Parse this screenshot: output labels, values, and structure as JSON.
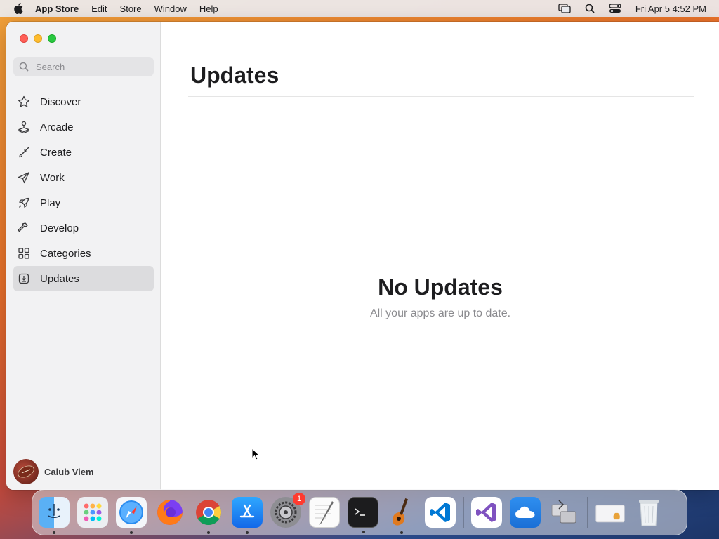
{
  "menubar": {
    "app_name": "App Store",
    "items": [
      "Edit",
      "Store",
      "Window",
      "Help"
    ],
    "datetime": "Fri Apr 5  4:52 PM"
  },
  "sidebar": {
    "search_placeholder": "Search",
    "items": [
      {
        "label": "Discover",
        "icon": "star-icon"
      },
      {
        "label": "Arcade",
        "icon": "joystick-icon"
      },
      {
        "label": "Create",
        "icon": "brush-icon"
      },
      {
        "label": "Work",
        "icon": "paperplane-icon"
      },
      {
        "label": "Play",
        "icon": "rocket-icon"
      },
      {
        "label": "Develop",
        "icon": "hammer-icon"
      },
      {
        "label": "Categories",
        "icon": "grid-icon"
      },
      {
        "label": "Updates",
        "icon": "download-icon",
        "active": true
      }
    ],
    "user_name": "Calub Viem"
  },
  "main": {
    "title": "Updates",
    "empty_title": "No Updates",
    "empty_subtitle": "All your apps are up to date."
  },
  "dock": {
    "apps": [
      "Finder",
      "Launchpad",
      "Safari",
      "Firefox",
      "Chrome",
      "App Store",
      "System Settings",
      "TextEdit",
      "Terminal",
      "GarageBand",
      "VS Code",
      "Visual Studio",
      "iCloud",
      "Migration Assistant",
      "Downloads",
      "Trash"
    ],
    "settings_badge": "1"
  },
  "colors": {
    "accent": "#007aff",
    "red": "#ff5f57",
    "yellow": "#febc2e",
    "green": "#28c840"
  }
}
